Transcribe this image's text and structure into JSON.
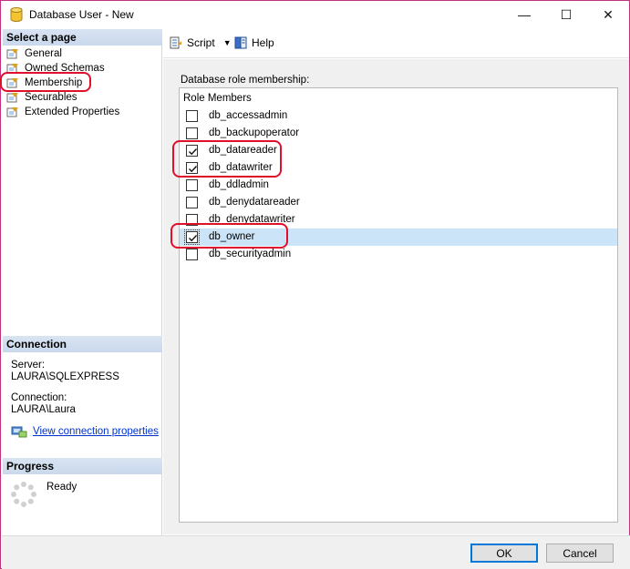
{
  "window": {
    "title": "Database User - New",
    "controls": {
      "minimize": "—",
      "maximize": "☐",
      "close": "✕"
    }
  },
  "left_pane": {
    "select_page_header": "Select a page",
    "pages": [
      {
        "label": "General",
        "icon": "wrench-page-icon"
      },
      {
        "label": "Owned Schemas",
        "icon": "wrench-page-icon"
      },
      {
        "label": "Membership",
        "icon": "wrench-page-icon"
      },
      {
        "label": "Securables",
        "icon": "wrench-page-icon"
      },
      {
        "label": "Extended Properties",
        "icon": "wrench-page-icon"
      }
    ],
    "connection_header": "Connection",
    "server_label": "Server:",
    "server_value": "LAURA\\SQLEXPRESS",
    "connection_label": "Connection:",
    "connection_value": "LAURA\\Laura",
    "view_connection_link": "View connection properties",
    "progress_header": "Progress",
    "progress_status": "Ready"
  },
  "toolbar": {
    "script_label": "Script",
    "help_label": "Help"
  },
  "main": {
    "section_label": "Database role membership:",
    "list_header": "Role Members",
    "roles": [
      {
        "name": "db_accessadmin",
        "checked": false
      },
      {
        "name": "db_backupoperator",
        "checked": false
      },
      {
        "name": "db_datareader",
        "checked": true
      },
      {
        "name": "db_datawriter",
        "checked": true
      },
      {
        "name": "db_ddladmin",
        "checked": false
      },
      {
        "name": "db_denydatareader",
        "checked": false
      },
      {
        "name": "db_denydatawriter",
        "checked": false
      },
      {
        "name": "db_owner",
        "checked": true,
        "selected": true
      },
      {
        "name": "db_securityadmin",
        "checked": false
      }
    ]
  },
  "footer": {
    "ok_label": "OK",
    "cancel_label": "Cancel"
  },
  "colors": {
    "annotation": "#e0102a",
    "selection": "#cce4f7",
    "link": "#0033cc",
    "section_header": "#d9e4f2"
  }
}
